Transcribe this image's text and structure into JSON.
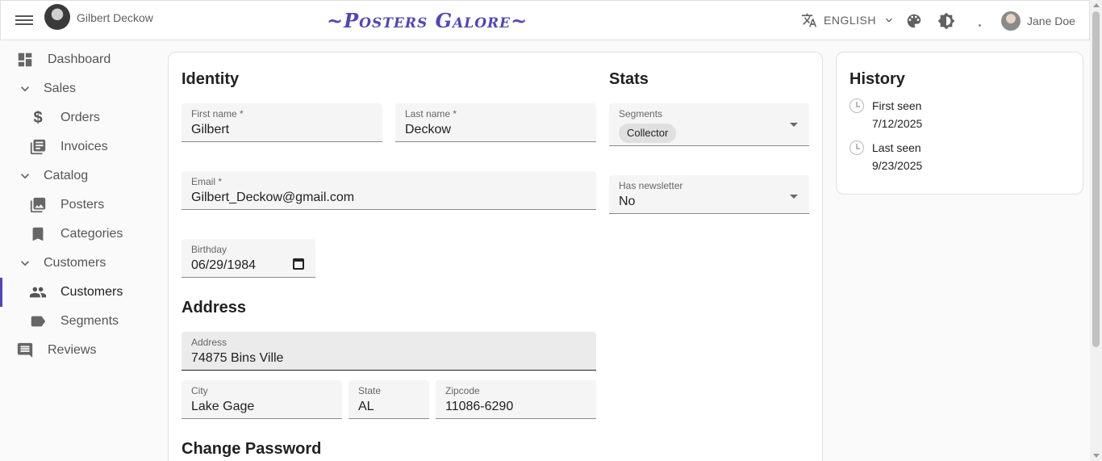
{
  "appbar": {
    "user_name": "Gilbert Deckow",
    "brand": "~Posters Galore~",
    "language": "ENGLISH",
    "admin_name": "Jane Doe"
  },
  "sidebar": {
    "items": [
      {
        "label": "Dashboard",
        "icon": "dashboard-icon"
      },
      {
        "label": "Sales",
        "icon": "chevron-down-icon"
      },
      {
        "label": "Orders",
        "icon": "dollar-icon"
      },
      {
        "label": "Invoices",
        "icon": "invoices-icon"
      },
      {
        "label": "Catalog",
        "icon": "chevron-down-icon"
      },
      {
        "label": "Posters",
        "icon": "image-icon"
      },
      {
        "label": "Categories",
        "icon": "bookmark-icon"
      },
      {
        "label": "Customers",
        "icon": "chevron-down-icon"
      },
      {
        "label": "Customers",
        "icon": "people-icon"
      },
      {
        "label": "Segments",
        "icon": "label-icon"
      },
      {
        "label": "Reviews",
        "icon": "comment-icon"
      }
    ]
  },
  "form": {
    "identity_title": "Identity",
    "stats_title": "Stats",
    "address_title": "Address",
    "password_title": "Change Password",
    "first_name": {
      "label": "First name *",
      "value": "Gilbert"
    },
    "last_name": {
      "label": "Last name *",
      "value": "Deckow"
    },
    "email": {
      "label": "Email *",
      "value": "Gilbert_Deckow@gmail.com"
    },
    "birthday": {
      "label": "Birthday",
      "value": "06/29/1984"
    },
    "segments": {
      "label": "Segments",
      "chip": "Collector"
    },
    "newsletter": {
      "label": "Has newsletter",
      "value": "No"
    },
    "address": {
      "label": "Address",
      "value": "74875 Bins Ville"
    },
    "city": {
      "label": "City",
      "value": "Lake Gage"
    },
    "state": {
      "label": "State",
      "value": "AL"
    },
    "zipcode": {
      "label": "Zipcode",
      "value": "11086-6290"
    }
  },
  "history": {
    "title": "History",
    "first_seen_label": "First seen",
    "first_seen_value": "7/12/2025",
    "last_seen_label": "Last seen",
    "last_seen_value": "9/23/2025"
  },
  "colors": {
    "brand": "#4f46b8",
    "active_indicator": "#4f46b8"
  }
}
